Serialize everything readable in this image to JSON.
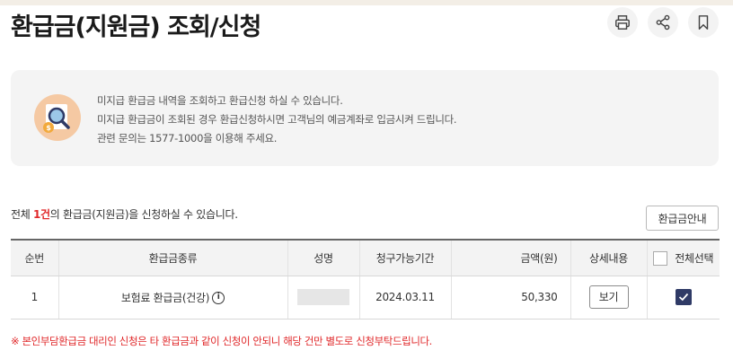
{
  "page": {
    "title": "환급금(지원금) 조회/신청"
  },
  "toolbar": {
    "print_icon": "printer-icon",
    "share_icon": "share-icon",
    "bookmark_icon": "bookmark-icon"
  },
  "info": {
    "icon": "money-search-icon",
    "lines": [
      "미지급 환급금 내역을 조회하고 환급신청 하실 수 있습니다.",
      "미지급 환급금이 조회된 경우 환급신청하시면 고객님의 예금계좌로 입금시켜 드립니다.",
      "관련 문의는 1577-1000을 이용해 주세요."
    ]
  },
  "summary": {
    "prefix": "전체 ",
    "count": "1건",
    "suffix": "의 환급금(지원금)을 신청하실 수 있습니다."
  },
  "guide_button": "환급금안내",
  "table": {
    "headers": {
      "no": "순번",
      "type": "환급금종류",
      "name": "성명",
      "period": "청구가능기간",
      "amount": "금액(원)",
      "detail": "상세내용",
      "select_all": "전체선택"
    },
    "rows": [
      {
        "no": "1",
        "type": "보험료 환급금(건강)",
        "info_glyph": "i",
        "name": "",
        "period": "2024.03.11",
        "amount": "50,330",
        "detail_button": "보기",
        "checked": true
      }
    ]
  },
  "notice": "※ 본인부담환급금 대리인 신청은 타 환급금과 같이 신청이 안되니 해당 건만 별도로 신청부탁드립니다.",
  "colors": {
    "accent_red": "#e0282a",
    "check_navy": "#2f3a66",
    "info_bg": "#f4f4f4"
  }
}
